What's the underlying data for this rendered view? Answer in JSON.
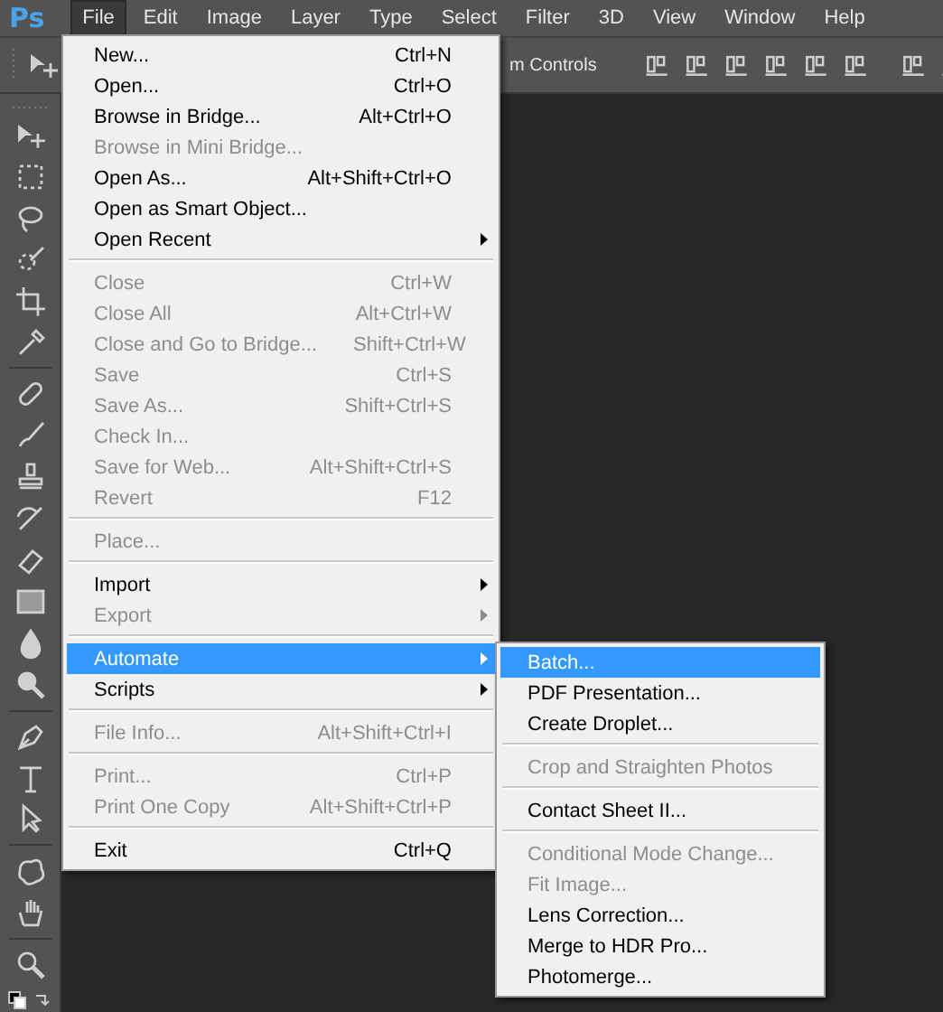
{
  "app_logo": "Ps",
  "menubar": [
    {
      "label": "File",
      "selected": true
    },
    {
      "label": "Edit",
      "selected": false
    },
    {
      "label": "Image",
      "selected": false
    },
    {
      "label": "Layer",
      "selected": false
    },
    {
      "label": "Type",
      "selected": false
    },
    {
      "label": "Select",
      "selected": false
    },
    {
      "label": "Filter",
      "selected": false
    },
    {
      "label": "3D",
      "selected": false
    },
    {
      "label": "View",
      "selected": false
    },
    {
      "label": "Window",
      "selected": false
    },
    {
      "label": "Help",
      "selected": false
    }
  ],
  "options_bar": {
    "text": "m Controls"
  },
  "file_menu": [
    {
      "kind": "item",
      "label": "New...",
      "shortcut": "Ctrl+N",
      "disabled": false,
      "selected": false,
      "submenu": false
    },
    {
      "kind": "item",
      "label": "Open...",
      "shortcut": "Ctrl+O",
      "disabled": false,
      "selected": false,
      "submenu": false
    },
    {
      "kind": "item",
      "label": "Browse in Bridge...",
      "shortcut": "Alt+Ctrl+O",
      "disabled": false,
      "selected": false,
      "submenu": false
    },
    {
      "kind": "item",
      "label": "Browse in Mini Bridge...",
      "disabled": true,
      "selected": false,
      "submenu": false
    },
    {
      "kind": "item",
      "label": "Open As...",
      "shortcut": "Alt+Shift+Ctrl+O",
      "disabled": false,
      "selected": false,
      "submenu": false
    },
    {
      "kind": "item",
      "label": "Open as Smart Object...",
      "disabled": false,
      "selected": false,
      "submenu": false
    },
    {
      "kind": "item",
      "label": "Open Recent",
      "disabled": false,
      "selected": false,
      "submenu": true
    },
    {
      "kind": "separator"
    },
    {
      "kind": "item",
      "label": "Close",
      "shortcut": "Ctrl+W",
      "disabled": true,
      "selected": false,
      "submenu": false
    },
    {
      "kind": "item",
      "label": "Close All",
      "shortcut": "Alt+Ctrl+W",
      "disabled": true,
      "selected": false,
      "submenu": false
    },
    {
      "kind": "item",
      "label": "Close and Go to Bridge...",
      "shortcut": "Shift+Ctrl+W",
      "disabled": true,
      "selected": false,
      "submenu": false
    },
    {
      "kind": "item",
      "label": "Save",
      "shortcut": "Ctrl+S",
      "disabled": true,
      "selected": false,
      "submenu": false
    },
    {
      "kind": "item",
      "label": "Save As...",
      "shortcut": "Shift+Ctrl+S",
      "disabled": true,
      "selected": false,
      "submenu": false
    },
    {
      "kind": "item",
      "label": "Check In...",
      "disabled": true,
      "selected": false,
      "submenu": false
    },
    {
      "kind": "item",
      "label": "Save for Web...",
      "shortcut": "Alt+Shift+Ctrl+S",
      "disabled": true,
      "selected": false,
      "submenu": false
    },
    {
      "kind": "item",
      "label": "Revert",
      "shortcut": "F12",
      "disabled": true,
      "selected": false,
      "submenu": false
    },
    {
      "kind": "separator"
    },
    {
      "kind": "item",
      "label": "Place...",
      "disabled": true,
      "selected": false,
      "submenu": false
    },
    {
      "kind": "separator"
    },
    {
      "kind": "item",
      "label": "Import",
      "disabled": false,
      "selected": false,
      "submenu": true
    },
    {
      "kind": "item",
      "label": "Export",
      "disabled": true,
      "selected": false,
      "submenu": true
    },
    {
      "kind": "separator"
    },
    {
      "kind": "item",
      "label": "Automate",
      "disabled": false,
      "selected": true,
      "submenu": true
    },
    {
      "kind": "item",
      "label": "Scripts",
      "disabled": false,
      "selected": false,
      "submenu": true
    },
    {
      "kind": "separator"
    },
    {
      "kind": "item",
      "label": "File Info...",
      "shortcut": "Alt+Shift+Ctrl+I",
      "disabled": true,
      "selected": false,
      "submenu": false
    },
    {
      "kind": "separator"
    },
    {
      "kind": "item",
      "label": "Print...",
      "shortcut": "Ctrl+P",
      "disabled": true,
      "selected": false,
      "submenu": false
    },
    {
      "kind": "item",
      "label": "Print One Copy",
      "shortcut": "Alt+Shift+Ctrl+P",
      "disabled": true,
      "selected": false,
      "submenu": false
    },
    {
      "kind": "separator"
    },
    {
      "kind": "item",
      "label": "Exit",
      "shortcut": "Ctrl+Q",
      "disabled": false,
      "selected": false,
      "submenu": false
    }
  ],
  "automate_submenu": [
    {
      "kind": "item",
      "label": "Batch...",
      "disabled": false,
      "selected": true,
      "submenu": false
    },
    {
      "kind": "item",
      "label": "PDF Presentation...",
      "disabled": false,
      "selected": false,
      "submenu": false
    },
    {
      "kind": "item",
      "label": "Create Droplet...",
      "disabled": false,
      "selected": false,
      "submenu": false
    },
    {
      "kind": "separator"
    },
    {
      "kind": "item",
      "label": "Crop and Straighten Photos",
      "disabled": true,
      "selected": false,
      "submenu": false
    },
    {
      "kind": "separator"
    },
    {
      "kind": "item",
      "label": "Contact Sheet II...",
      "disabled": false,
      "selected": false,
      "submenu": false
    },
    {
      "kind": "separator"
    },
    {
      "kind": "item",
      "label": "Conditional Mode Change...",
      "disabled": true,
      "selected": false,
      "submenu": false
    },
    {
      "kind": "item",
      "label": "Fit Image...",
      "disabled": true,
      "selected": false,
      "submenu": false
    },
    {
      "kind": "item",
      "label": "Lens Correction...",
      "disabled": false,
      "selected": false,
      "submenu": false
    },
    {
      "kind": "item",
      "label": "Merge to HDR Pro...",
      "disabled": false,
      "selected": false,
      "submenu": false
    },
    {
      "kind": "item",
      "label": "Photomerge...",
      "disabled": false,
      "selected": false,
      "submenu": false
    }
  ]
}
